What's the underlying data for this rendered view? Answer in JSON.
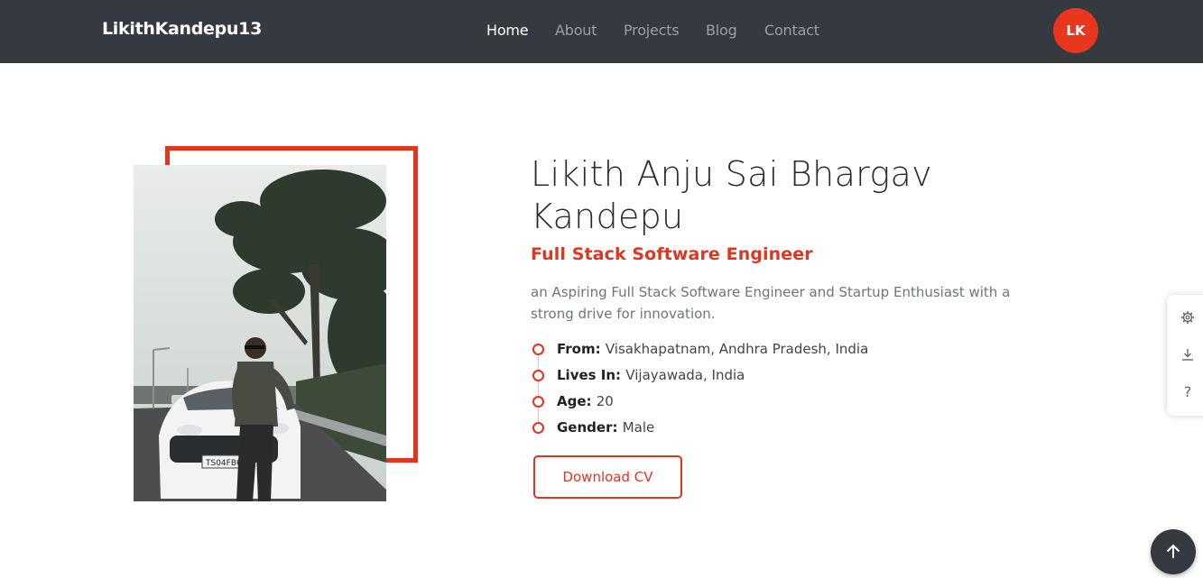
{
  "navbar": {
    "brand": "LikithKandepu13",
    "links": [
      {
        "label": "Home",
        "active": true
      },
      {
        "label": "About",
        "active": false
      },
      {
        "label": "Projects",
        "active": false
      },
      {
        "label": "Blog",
        "active": false
      },
      {
        "label": "Contact",
        "active": false
      }
    ],
    "avatar_initials": "LK"
  },
  "profile": {
    "name": "Likith Anju Sai Bhargav Kandepu",
    "role": "Full Stack Software Engineer",
    "description": "an Aspiring Full Stack Software Engineer and Startup Enthusiast with a strong drive for innovation.",
    "info": [
      {
        "label": "From:",
        "value": "Visakhapatnam, Andhra Pradesh, India"
      },
      {
        "label": "Lives In:",
        "value": "Vijayawada, India"
      },
      {
        "label": "Age:",
        "value": "20"
      },
      {
        "label": "Gender:",
        "value": "Male"
      }
    ],
    "cv_button": "Download CV",
    "photo_plate": "TS04FB6"
  },
  "side_panel": {
    "icons": [
      "gear-icon",
      "download-icon",
      "help-icon"
    ]
  },
  "scroll_top": {
    "icon": "arrow-up-icon"
  },
  "colors": {
    "navbar_bg": "#343a40",
    "accent": "#e0351e",
    "avatar_bg": "#e8371e"
  }
}
